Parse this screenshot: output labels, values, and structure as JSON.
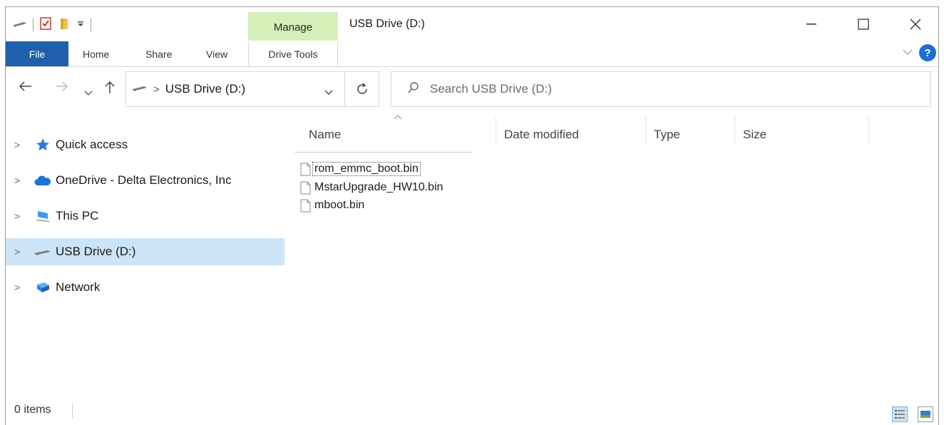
{
  "window": {
    "title": "USB Drive (D:)",
    "manage_tab": "Manage",
    "controls": {
      "minimize": "—",
      "maximize": "☐",
      "close": "✕"
    }
  },
  "ribbon": {
    "file": "File",
    "tabs": [
      "Home",
      "Share",
      "View"
    ],
    "drive_tools": "Drive Tools",
    "help": "?",
    "collapse": "⌵"
  },
  "address_bar": {
    "separator": ">",
    "location": "USB Drive (D:)",
    "dropdown": "⌵",
    "refresh": "↻"
  },
  "nav_buttons": {
    "back": "←",
    "forward": "→",
    "recent": "⌵",
    "up": "↑"
  },
  "search": {
    "placeholder": "Search USB Drive (D:)",
    "icon": "⚲"
  },
  "navigation_pane": {
    "items": [
      {
        "label": "Quick access",
        "icon": "star-icon",
        "expander": ">"
      },
      {
        "label": "OneDrive - Delta Electronics, Inc",
        "icon": "cloud-icon",
        "expander": ">"
      },
      {
        "label": "This PC",
        "icon": "computer-icon",
        "expander": ">"
      },
      {
        "label": "USB Drive (D:)",
        "icon": "drive-icon",
        "expander": ">",
        "selected": true
      },
      {
        "label": "Network",
        "icon": "network-icon",
        "expander": ">"
      }
    ]
  },
  "file_list": {
    "columns": [
      "Name",
      "Date modified",
      "Type",
      "Size"
    ],
    "sort_indicator": "^",
    "files": [
      {
        "name": "rom_emmc_boot.bin",
        "focused": true
      },
      {
        "name": "MstarUpgrade_HW10.bin"
      },
      {
        "name": "mboot.bin"
      }
    ]
  },
  "status_bar": {
    "items": "0 items"
  },
  "colors": {
    "file_tab": "#1f5fad",
    "manage_tab": "#d4f0b8",
    "selection": "#cce4f7",
    "help": "#1f6fd1"
  }
}
